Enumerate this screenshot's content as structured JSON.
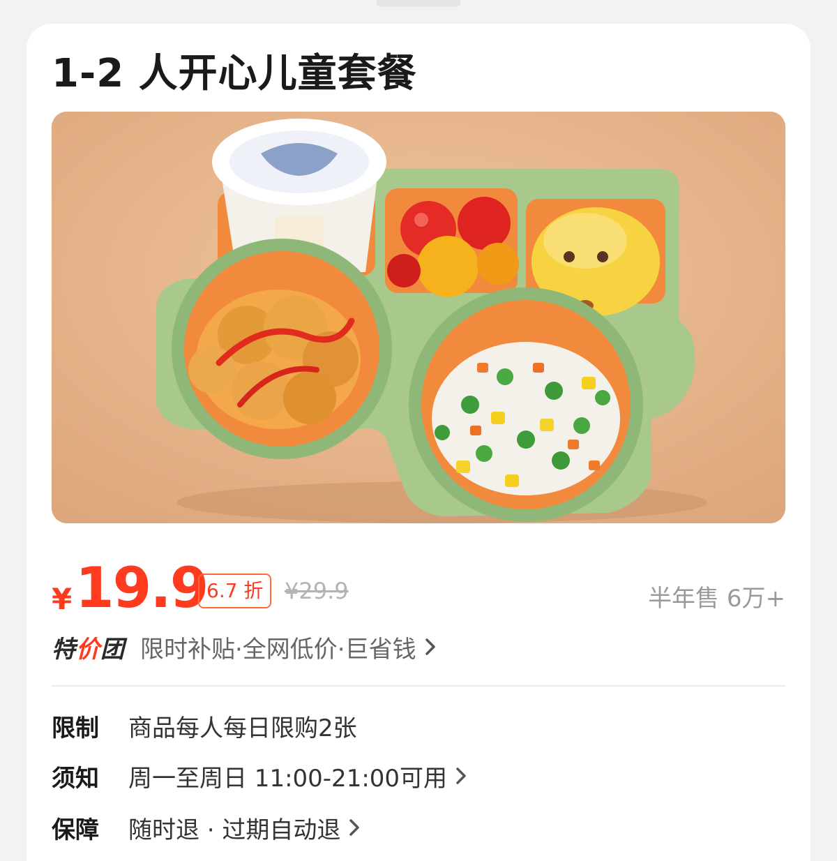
{
  "product": {
    "title": "1-2 人开心儿童套餐",
    "image_alt": "kids meal tray with yogurt, cherry tomatoes, bun, fried chicken and vegetable fried rice"
  },
  "price": {
    "currency": "¥",
    "current": "19.9",
    "discount": "6.7 折",
    "original": "¥29.9",
    "sales": "半年售 6万+"
  },
  "promo": {
    "logo_prefix": "特",
    "logo_accent": "价",
    "logo_suffix": "团",
    "text": "限时补贴·全网低价·巨省钱"
  },
  "info": {
    "limit_label": "限制",
    "limit_value": "商品每人每日限购2张",
    "notice_label": "须知",
    "notice_value": "周一至周日 11:00-21:00可用",
    "guarantee_label": "保障",
    "guarantee_value": "随时退 · 过期自动退"
  },
  "colors": {
    "price_red": "#ff3b1f",
    "muted_gray": "#9a9a9a",
    "tray_green": "#a9c98c",
    "background": "#e9b88c"
  },
  "icons": {
    "chevron": "chevron-right-icon"
  }
}
